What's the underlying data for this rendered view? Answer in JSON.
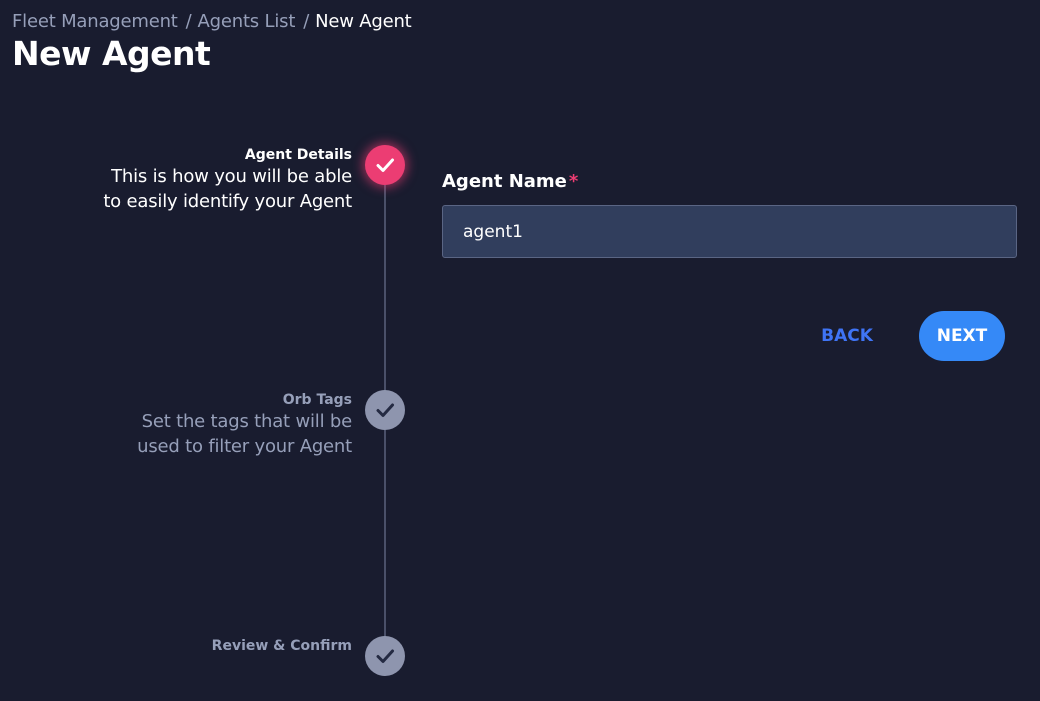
{
  "breadcrumb": {
    "items": [
      "Fleet Management",
      "Agents List",
      "New Agent"
    ],
    "separator": "/"
  },
  "page_title": "New Agent",
  "stepper": {
    "steps": [
      {
        "title": "Agent Details",
        "description_line1": "This is how you will be able",
        "description_line2": "to easily identify your Agent",
        "state": "active",
        "icon": "check-icon"
      },
      {
        "title": "Orb Tags",
        "description_line1": "Set the tags that will be",
        "description_line2": "used to filter your Agent",
        "state": "inactive",
        "icon": "check-icon"
      },
      {
        "title": "Review & Confirm",
        "state": "inactive",
        "icon": "check-icon"
      }
    ]
  },
  "form": {
    "agent_name_label": "Agent Name",
    "required_marker": "*",
    "agent_name_value": "agent1"
  },
  "actions": {
    "back_label": "BACK",
    "next_label": "NEXT"
  },
  "colors": {
    "background": "#191c2f",
    "accent_active": "#ec3d73",
    "step_inactive": "#8e95ae",
    "primary_button": "#3589f7",
    "link_button": "#3f74f5",
    "input_background": "#313e5d"
  }
}
